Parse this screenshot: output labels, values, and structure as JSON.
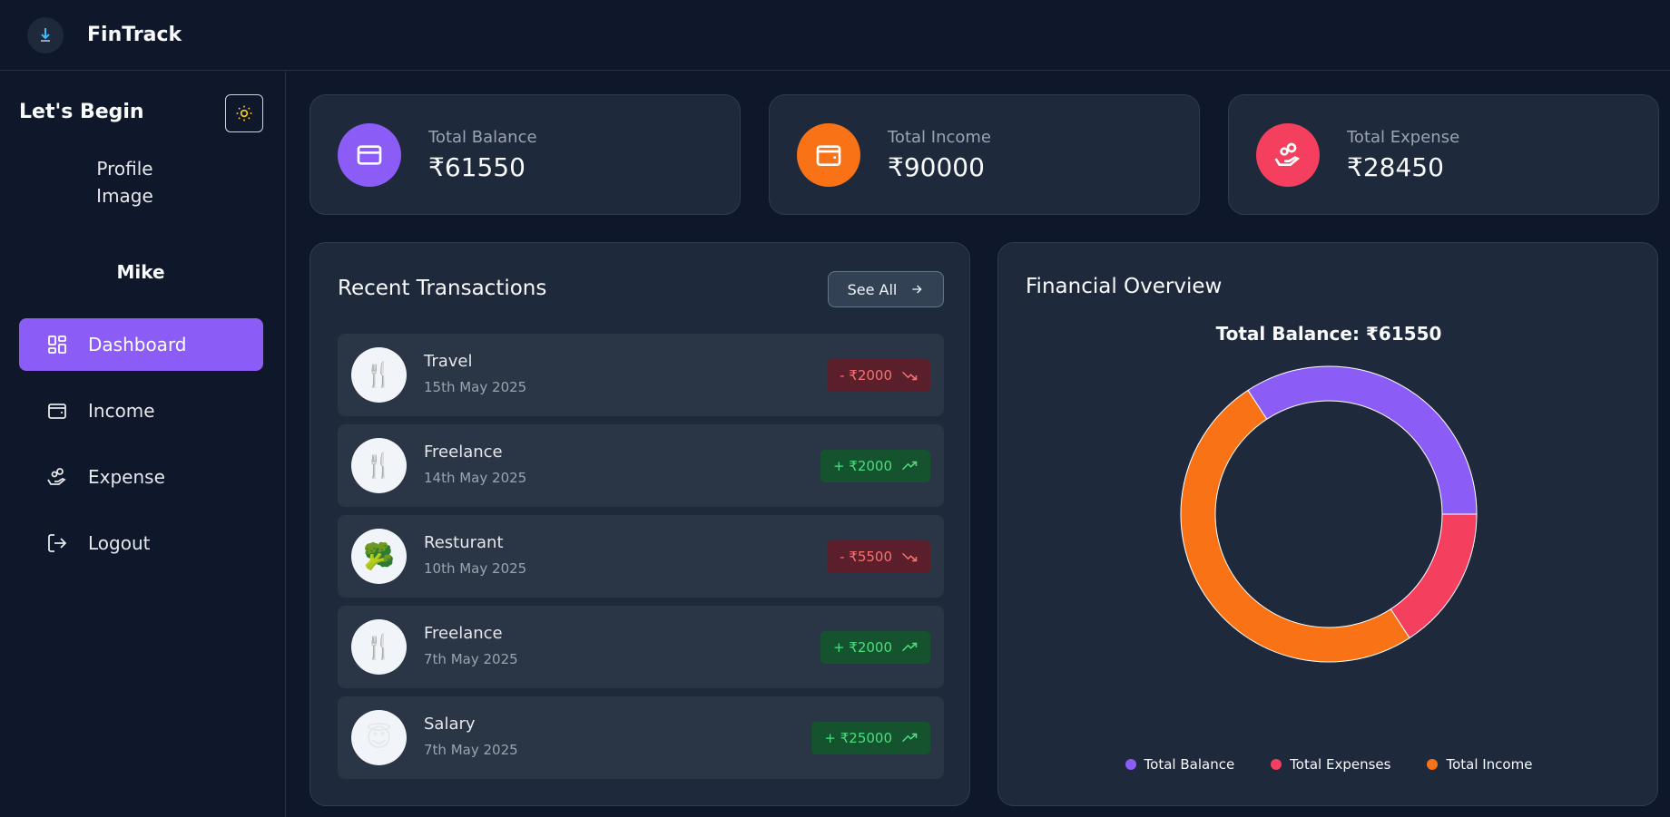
{
  "app": {
    "name": "FinTrack",
    "logo_icon": "app-logo-icon"
  },
  "sidebar": {
    "title": "Let's Begin",
    "theme_toggle_icon": "sun-icon",
    "profile_image_alt": "Profile Image",
    "user_name": "Mike",
    "items": [
      {
        "label": "Dashboard",
        "icon": "dashboard-icon",
        "active": true
      },
      {
        "label": "Income",
        "icon": "wallet-icon",
        "active": false
      },
      {
        "label": "Expense",
        "icon": "hand-coins-icon",
        "active": false
      },
      {
        "label": "Logout",
        "icon": "logout-icon",
        "active": false
      }
    ]
  },
  "stats": [
    {
      "label": "Total Balance",
      "value": "₹61550",
      "icon": "credit-card-icon",
      "color": "#8b5cf6"
    },
    {
      "label": "Total Income",
      "value": "₹90000",
      "icon": "wallet-icon",
      "color": "#f97316"
    },
    {
      "label": "Total Expense",
      "value": "₹28450",
      "icon": "hand-coins-icon",
      "color": "#f43f5e"
    }
  ],
  "transactions": {
    "title": "Recent Transactions",
    "see_all_label": "See All",
    "items": [
      {
        "title": "Travel",
        "date": "15th May 2025",
        "amount": "- ₹2000",
        "type": "expense",
        "icon": "utensils-icon"
      },
      {
        "title": "Freelance",
        "date": "14th May 2025",
        "amount": "+ ₹2000",
        "type": "income",
        "icon": "utensils-icon"
      },
      {
        "title": "Resturant",
        "date": "10th May 2025",
        "amount": "- ₹5500",
        "type": "expense",
        "icon": "broccoli-emoji"
      },
      {
        "title": "Freelance",
        "date": "7th May 2025",
        "amount": "+ ₹2000",
        "type": "income",
        "icon": "utensils-icon"
      },
      {
        "title": "Salary",
        "date": "7th May 2025",
        "amount": "+ ₹25000",
        "type": "income",
        "icon": "halo-smile-emoji"
      }
    ]
  },
  "overview": {
    "title": "Financial Overview",
    "total_label": "Total Balance: ₹61550"
  },
  "chart_data": {
    "type": "pie",
    "donut": true,
    "categories": [
      "Total Balance",
      "Total Expenses",
      "Total Income"
    ],
    "values": [
      61550,
      28450,
      90000
    ],
    "colors": [
      "#8b5cf6",
      "#f43f5e",
      "#f97316"
    ],
    "legend_position": "bottom"
  }
}
